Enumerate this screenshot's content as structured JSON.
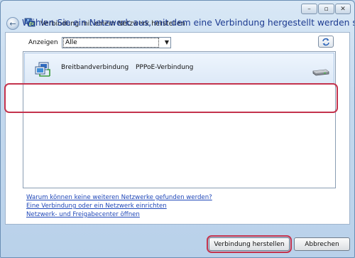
{
  "window": {
    "title": "Verbindung mit einem Netzwerk herstellen",
    "controls": {
      "minimize": "–",
      "maximize": "▫",
      "close": "✕"
    }
  },
  "heading": "Wählen Sie ein Netzwerk aus, mit dem eine Verbindung hergestellt werden soll:",
  "filter": {
    "label": "Anzeigen",
    "selected": "Alle"
  },
  "networks": [
    {
      "name": "Breitbandverbindung",
      "type": "PPPoE-Verbindung",
      "icon": "broadband-connection-icon",
      "selected": true
    }
  ],
  "links": [
    "Warum können keine weiteren Netzwerke gefunden werden?",
    "Eine Verbindung oder ein Netzwerk einrichten",
    "Netzwerk- und Freigabecenter öffnen"
  ],
  "buttons": {
    "connect": "Verbindung herstellen",
    "cancel": "Abbrechen"
  },
  "colors": {
    "heading": "#1c3a90",
    "link": "#1f47b8",
    "highlight": "#c4334d"
  }
}
